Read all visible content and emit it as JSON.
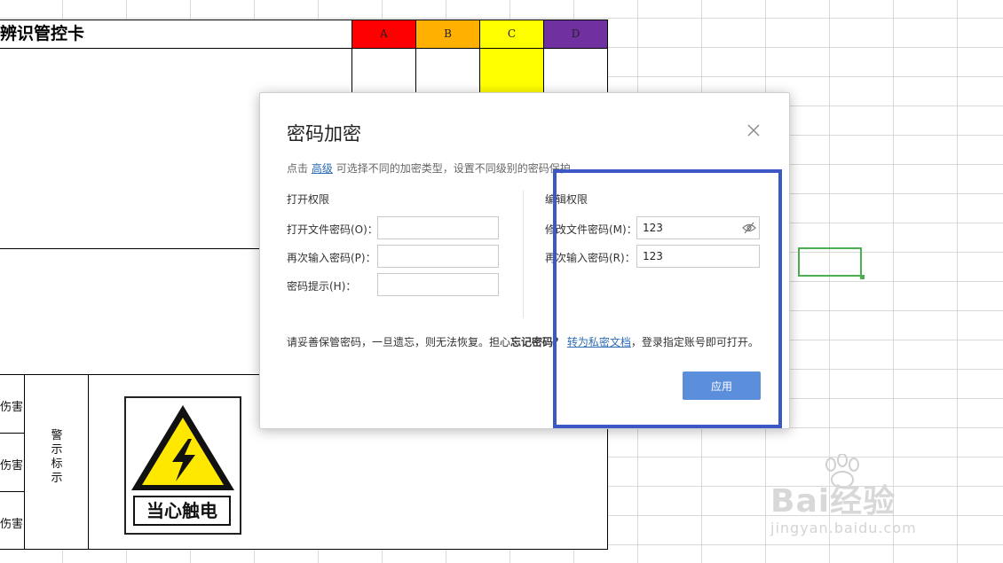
{
  "sheet": {
    "title": "辨识管控卡",
    "columns": [
      {
        "label": "A",
        "color": "#ff0000"
      },
      {
        "label": "B",
        "color": "#ffb000"
      },
      {
        "label": "C",
        "color": "#ffff00"
      },
      {
        "label": "D",
        "color": "#7030a0"
      }
    ],
    "hazard_rows": [
      "伤害",
      "伤害",
      "伤害"
    ],
    "warning_label": [
      "警",
      "示",
      "标",
      "示"
    ],
    "sign_text": "当心触电"
  },
  "dialog": {
    "title": "密码加密",
    "hint_prefix": "点击",
    "hint_link": "高级",
    "hint_suffix": "可选择不同的加密类型，设置不同级别的密码保护。",
    "open_section": "打开权限",
    "open_password_label": "打开文件密码(O)：",
    "open_password_value": "",
    "open_confirm_label": "再次输入密码(P)：",
    "open_confirm_value": "",
    "hint_label": "密码提示(H)：",
    "hint_value": "",
    "edit_section": "编辑权限",
    "edit_password_label": "修改文件密码(M)：",
    "edit_password_value": "123",
    "edit_confirm_label": "再次输入密码(R)：",
    "edit_confirm_value": "123",
    "footer_prefix": "请妥善保管密码，一旦遗忘，则无法恢复。担心",
    "footer_bold": "忘记密码？",
    "footer_link": "转为私密文档",
    "footer_suffix": "，登录指定账号即可打开。",
    "apply_label": "应用"
  },
  "watermark": {
    "brand": "Bai经验",
    "url": "jingyan.baidu.com"
  },
  "colors": {
    "accent": "#5b8fdb",
    "highlight": "#3c58c4",
    "selection": "#4caf50",
    "link": "#2d6db4"
  }
}
